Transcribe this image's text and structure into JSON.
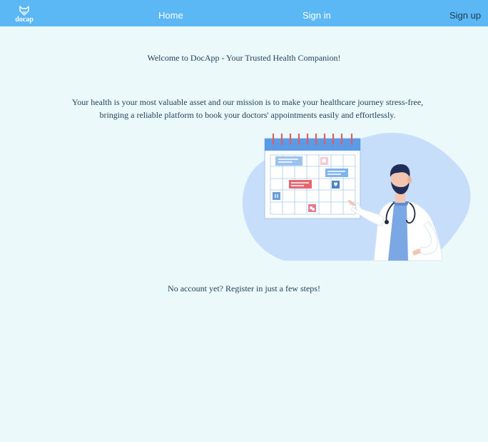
{
  "header": {
    "logo_text": "docap",
    "home_label": "Home",
    "signin_label": "Sign in",
    "signup_label": "Sign up"
  },
  "main": {
    "welcome_text": "Welcome to DocApp - Your Trusted Health Companion!",
    "mission_line1": "Your health is your most valuable asset and our mission is to make your healthcare journey stress-free,",
    "mission_line2": "bringing a reliable platform to book your doctors' appointments easily and effortlessly.",
    "register_text": "No account yet? Register in just a few steps!"
  },
  "colors": {
    "navbar": "#5cb8f4",
    "background": "#ebf9fb",
    "text": "#1f3f5b",
    "blob": "#c7defb"
  },
  "icons": {
    "logo": "fox-head-icon"
  }
}
